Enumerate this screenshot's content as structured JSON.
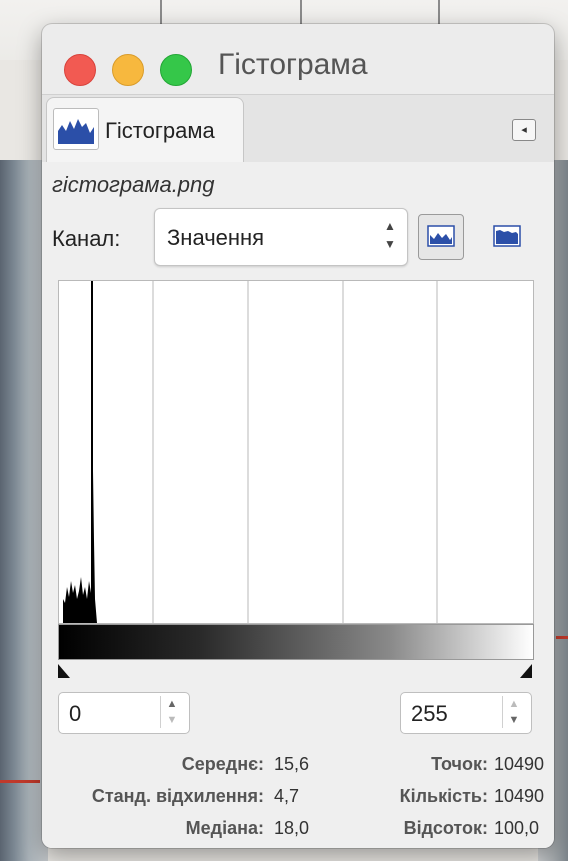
{
  "window": {
    "title": "Гістограма"
  },
  "tab": {
    "label": "Гістограма",
    "icon": "histogram-icon",
    "menu_icon": "tab-menu-icon"
  },
  "panel": {
    "filename": "гістограма.png",
    "channel_label": "Канал:",
    "channel_value": "Значення",
    "linear_button_icon": "linear-histogram-icon",
    "log_button_icon": "log-histogram-icon"
  },
  "range": {
    "start": "0",
    "end": "255"
  },
  "stats": {
    "mean_label": "Середнє:",
    "mean_value": "15,6",
    "stddev_label": "Станд. відхилення:",
    "stddev_value": "4,7",
    "median_label": "Медіана:",
    "median_value": "18,0",
    "pixels_label": "Точок:",
    "pixels_value": "10490",
    "count_label": "Кількість:",
    "count_value": "10490",
    "percentile_label": "Відсоток:",
    "percentile_value": "100,0"
  },
  "colors": {
    "close": "#f25a52",
    "minimize": "#f7b83e",
    "zoom": "#35c749",
    "histogram_icon": "#2b4fa8"
  }
}
